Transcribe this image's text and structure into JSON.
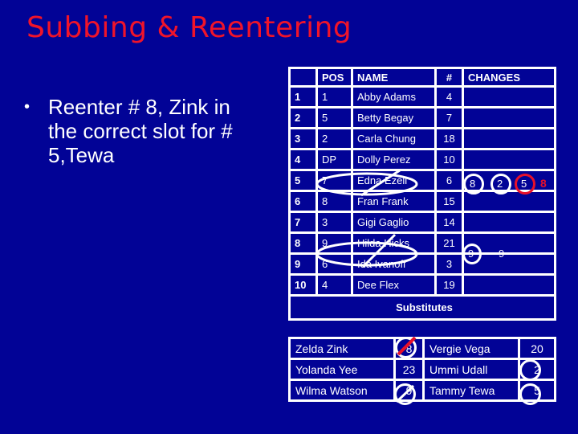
{
  "title": "Subbing & Reentering",
  "bullet": {
    "symbol": "•",
    "text": "Reenter # 8, Zink in the correct slot for # 5,Tewa"
  },
  "lineup": {
    "headers": [
      "",
      "POS",
      "NAME",
      "#",
      "CHANGES"
    ],
    "rows": [
      {
        "slot": "1",
        "pos": "1",
        "name": "Abby Adams",
        "num": "4"
      },
      {
        "slot": "2",
        "pos": "5",
        "name": "Betty Begay",
        "num": "7"
      },
      {
        "slot": "3",
        "pos": "2",
        "name": "Carla Chung",
        "num": "18"
      },
      {
        "slot": "4",
        "pos": "DP",
        "name": "Dolly Perez",
        "num": "10"
      },
      {
        "slot": "5",
        "pos": "7",
        "name": "Edna Ezell",
        "num": "6",
        "crossed_out": true
      },
      {
        "slot": "6",
        "pos": "8",
        "name": "Fran Frank",
        "num": "15"
      },
      {
        "slot": "7",
        "pos": "3",
        "name": "Gigi Gaglio",
        "num": "14"
      },
      {
        "slot": "8",
        "pos": "9",
        "name": "Hilda Hicks",
        "num": "21",
        "crossed_out": true
      },
      {
        "slot": "9",
        "pos": "6",
        "name": "Ida Ivanoff",
        "num": "3"
      },
      {
        "slot": "10",
        "pos": "4",
        "name": "Dee Flex",
        "num": "19"
      }
    ],
    "changes": {
      "slot5": [
        {
          "value": "8",
          "circled": true,
          "color": "#ffffff"
        },
        {
          "value": "2",
          "circled": true,
          "color": "#ffffff"
        },
        {
          "value": "5",
          "circled": true,
          "color": "#e8102a"
        },
        {
          "value": "8",
          "circled": false,
          "color": "#e8102a"
        }
      ],
      "slot8": [
        {
          "value": "9",
          "circled": true,
          "color": "#ffffff"
        },
        {
          "value": "9",
          "circled": false,
          "color": "#ffffff"
        }
      ]
    }
  },
  "substitutes": {
    "label": "Substitutes",
    "rows": [
      {
        "left_name": "Zelda Zink",
        "left_num": "8",
        "right_name": "Vergie Vega",
        "right_num": "20"
      },
      {
        "left_name": "Yolanda Yee",
        "left_num": "23",
        "right_name": "Ummi Udall",
        "right_num": "2"
      },
      {
        "left_name": "Wilma Watson",
        "left_num": "9",
        "right_name": "Tammy Tewa",
        "right_num": "5"
      }
    ]
  },
  "colors": {
    "background": "#020396",
    "title": "#f0142a",
    "highlight": "#e8102a",
    "text": "#ffffff"
  }
}
